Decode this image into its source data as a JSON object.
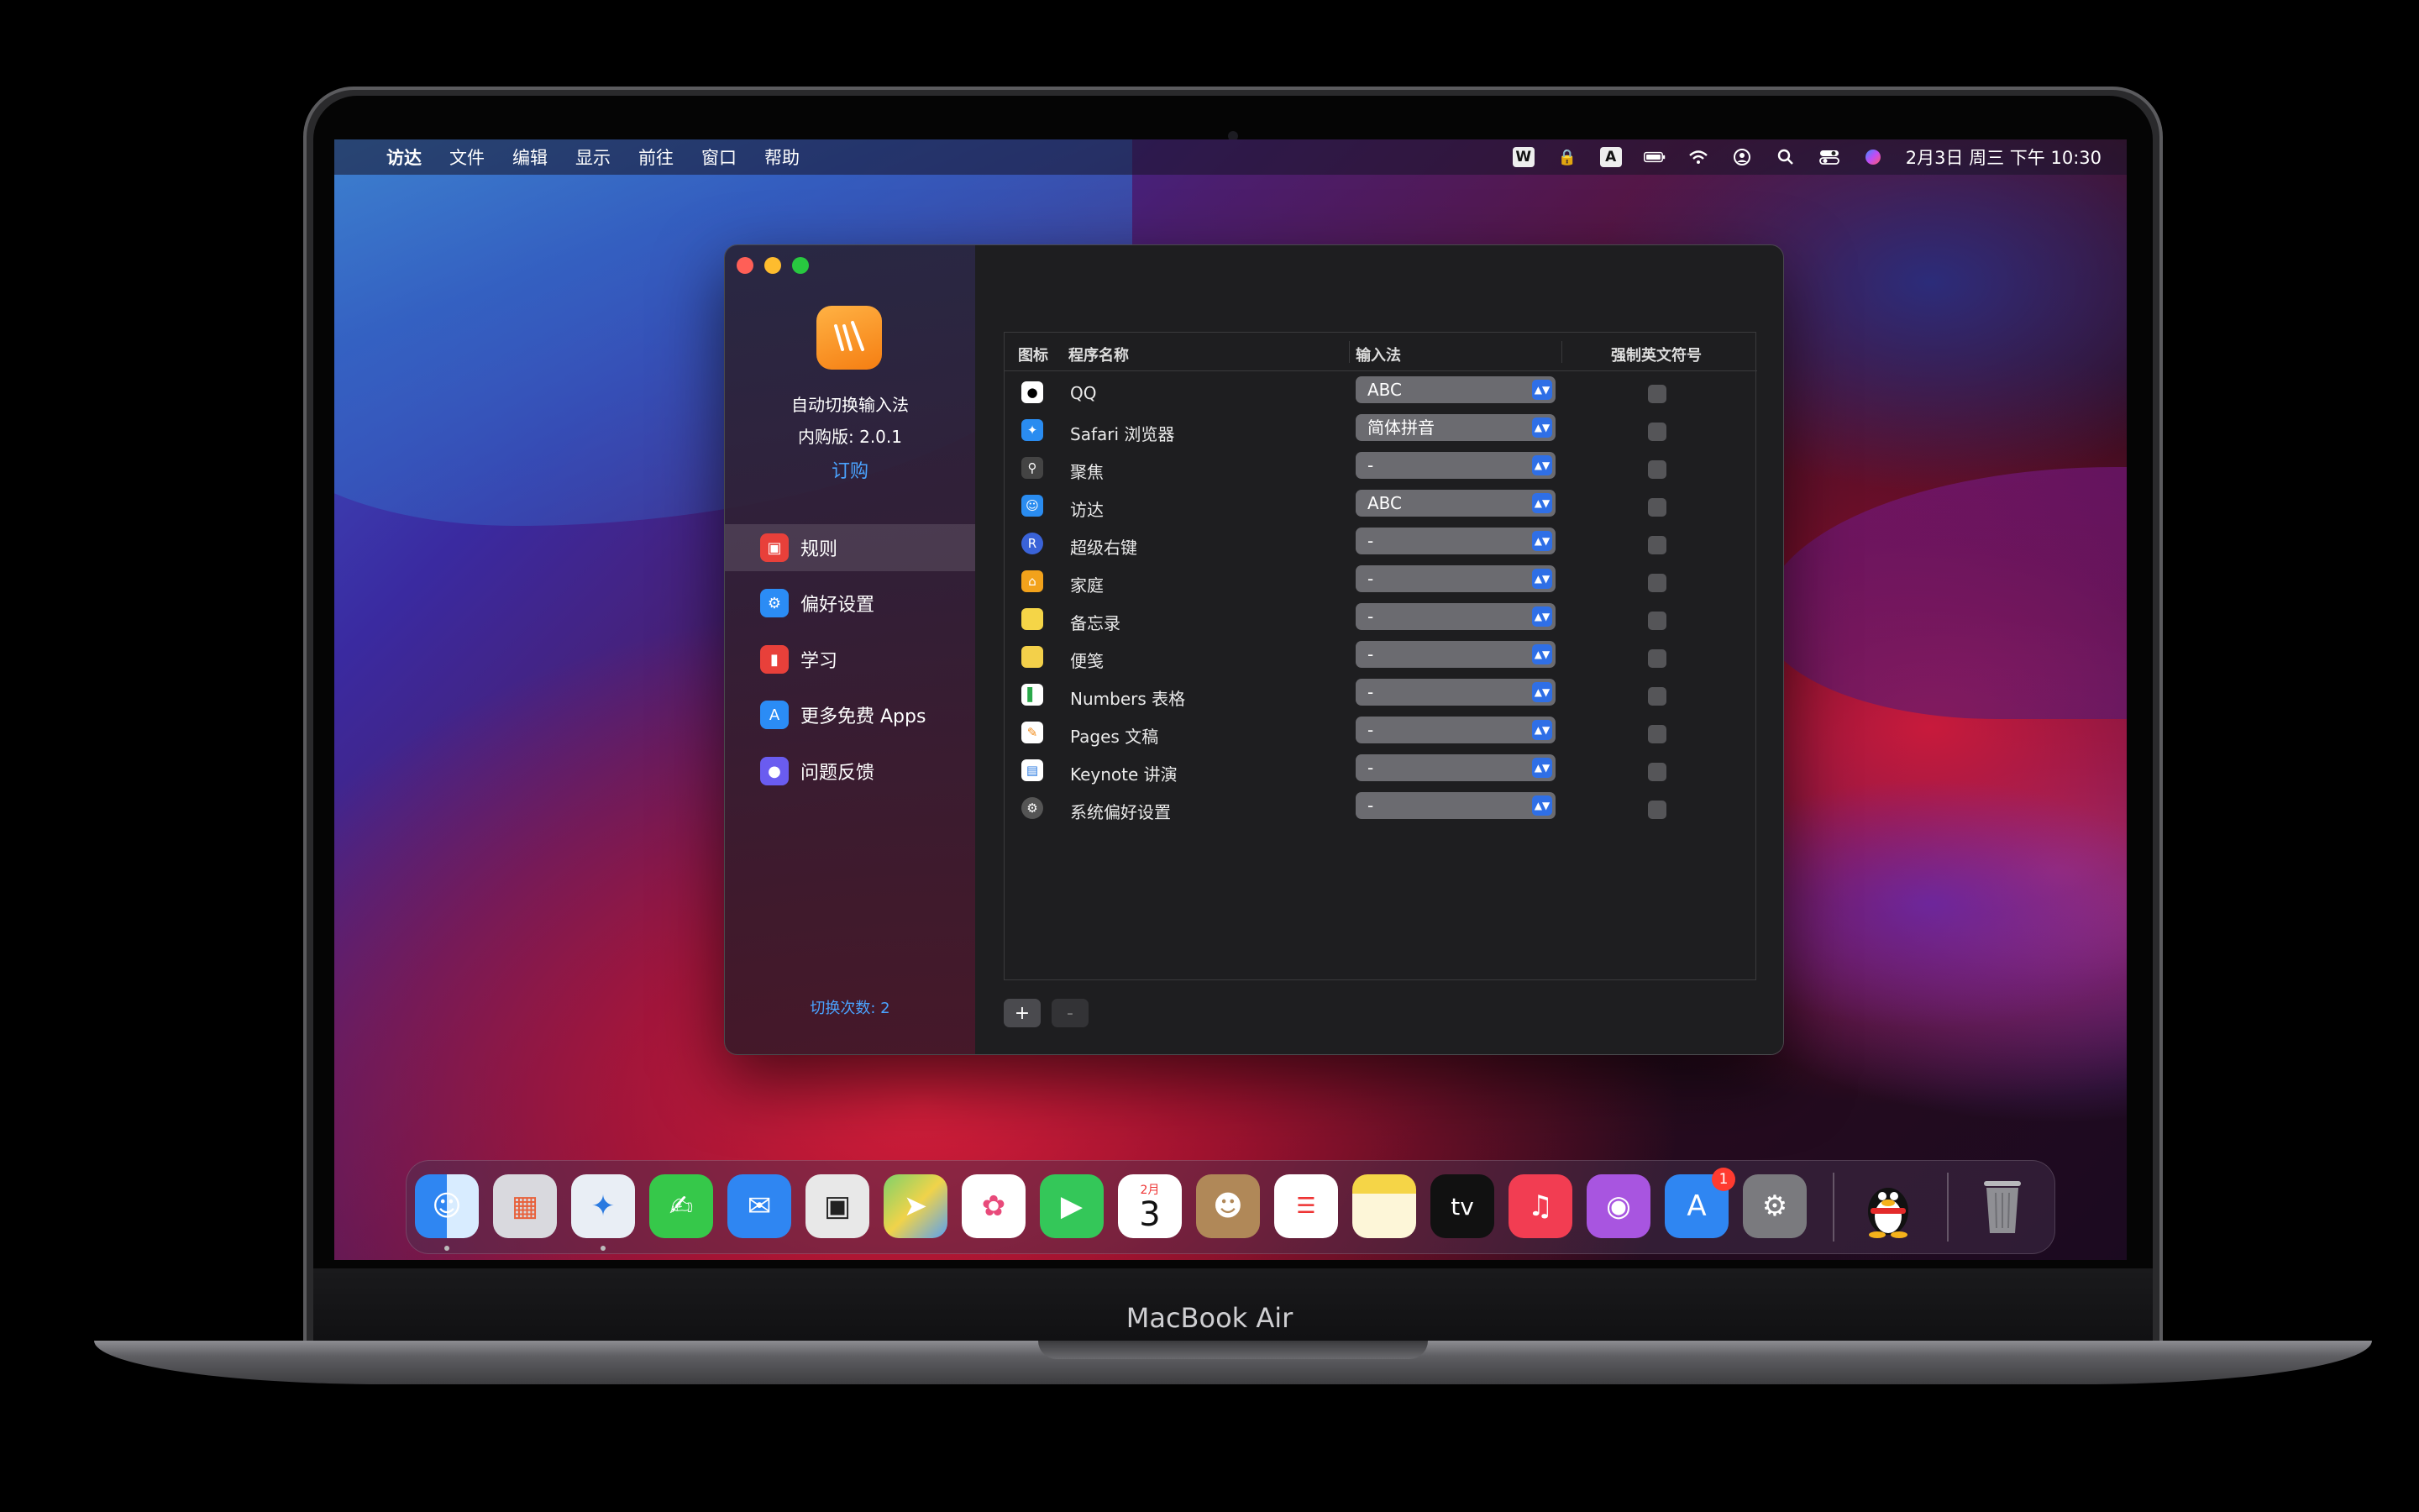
{
  "menubar": {
    "items": [
      "访达",
      "文件",
      "编辑",
      "显示",
      "前往",
      "窗口",
      "帮助"
    ],
    "status_icons": [
      "wps-icon",
      "lock-icon",
      "input-a-icon",
      "battery-icon",
      "wifi-icon",
      "user-icon",
      "search-icon",
      "control-center-icon",
      "siri-icon"
    ],
    "input_source": "A",
    "clock": "2月3日 周三 下午 10:30"
  },
  "app": {
    "name": "自动切换输入法",
    "version": "内购版: 2.0.1",
    "buy": "订购",
    "switch_count": "切换次数: 2"
  },
  "sidebar": {
    "items": [
      {
        "label": "规则",
        "icon": "rules-icon",
        "color": "#e8403a"
      },
      {
        "label": "偏好设置",
        "icon": "gear-icon",
        "color": "#2b8cf5"
      },
      {
        "label": "学习",
        "icon": "book-icon",
        "color": "#e8403a"
      },
      {
        "label": "更多免费 Apps",
        "icon": "appstore-icon",
        "color": "#2b8cf5"
      },
      {
        "label": "问题反馈",
        "icon": "people-icon",
        "color": "#6a5cf0"
      }
    ]
  },
  "table": {
    "headers": [
      "图标",
      "程序名称",
      "输入法",
      "强制英文符号"
    ],
    "rows": [
      {
        "name": "QQ",
        "im": "ABC",
        "icon": "qq-icon",
        "color": "#222"
      },
      {
        "name": "Safari 浏览器",
        "im": "简体拼音",
        "icon": "safari-icon",
        "color": "#2a8cf0"
      },
      {
        "name": "聚焦",
        "im": "-",
        "icon": "spotlight-icon",
        "color": "#444"
      },
      {
        "name": "访达",
        "im": "ABC",
        "icon": "finder-icon",
        "color": "#2a8cf0"
      },
      {
        "name": "超级右键",
        "im": "-",
        "icon": "rclick-icon",
        "color": "#3a63d8"
      },
      {
        "name": "家庭",
        "im": "-",
        "icon": "home-icon",
        "color": "#f2a21b"
      },
      {
        "name": "备忘录",
        "im": "-",
        "icon": "notes-icon",
        "color": "#f5d547"
      },
      {
        "name": "便笺",
        "im": "-",
        "icon": "stickies-icon",
        "color": "#f3d04a"
      },
      {
        "name": "Numbers 表格",
        "im": "-",
        "icon": "numbers-icon",
        "color": "#ffffff"
      },
      {
        "name": "Pages 文稿",
        "im": "-",
        "icon": "pages-icon",
        "color": "#ffffff"
      },
      {
        "name": "Keynote 讲演",
        "im": "-",
        "icon": "keynote-icon",
        "color": "#ffffff"
      },
      {
        "name": "系统偏好设置",
        "im": "-",
        "icon": "syspref-icon",
        "color": "#555"
      }
    ],
    "add_button": "+",
    "remove_button": "-"
  },
  "dock": {
    "apps": [
      {
        "name": "finder-icon",
        "color": "#2f86f2",
        "running": true
      },
      {
        "name": "launchpad-icon",
        "color": "#d9d9de",
        "running": false
      },
      {
        "name": "safari-icon",
        "color": "#e9eef5",
        "running": true
      },
      {
        "name": "messages-icon",
        "color": "#36c84a",
        "running": false
      },
      {
        "name": "mail-icon",
        "color": "#2f86f2",
        "running": false
      },
      {
        "name": "screenshot-icon",
        "color": "#e8e8e8",
        "running": false
      },
      {
        "name": "maps-icon",
        "color": "#7fd26a",
        "running": false
      },
      {
        "name": "photos-icon",
        "color": "#ffffff",
        "running": false
      },
      {
        "name": "facetime-icon",
        "color": "#34c759",
        "running": false
      },
      {
        "name": "calendar-icon",
        "color": "#ffffff",
        "running": false
      },
      {
        "name": "contacts-icon",
        "color": "#b08858",
        "running": false
      },
      {
        "name": "reminders-icon",
        "color": "#ffffff",
        "running": false
      },
      {
        "name": "notes-icon",
        "color": "#f5d547",
        "running": false
      },
      {
        "name": "tv-icon",
        "color": "#111111",
        "running": false
      },
      {
        "name": "music-icon",
        "color": "#f23d52",
        "running": false
      },
      {
        "name": "podcasts-icon",
        "color": "#a855e0",
        "running": false
      },
      {
        "name": "appstore-icon",
        "color": "#2f86f2",
        "running": false
      },
      {
        "name": "system-preferences-icon",
        "color": "#7a7a7e",
        "running": false
      }
    ],
    "calendar_month": "2月",
    "calendar_day": "3",
    "tv_label": "tv",
    "appstore_badge": "1",
    "qq": "qq-icon",
    "trash": "trash-icon"
  },
  "device": {
    "brand": "MacBook Air"
  }
}
